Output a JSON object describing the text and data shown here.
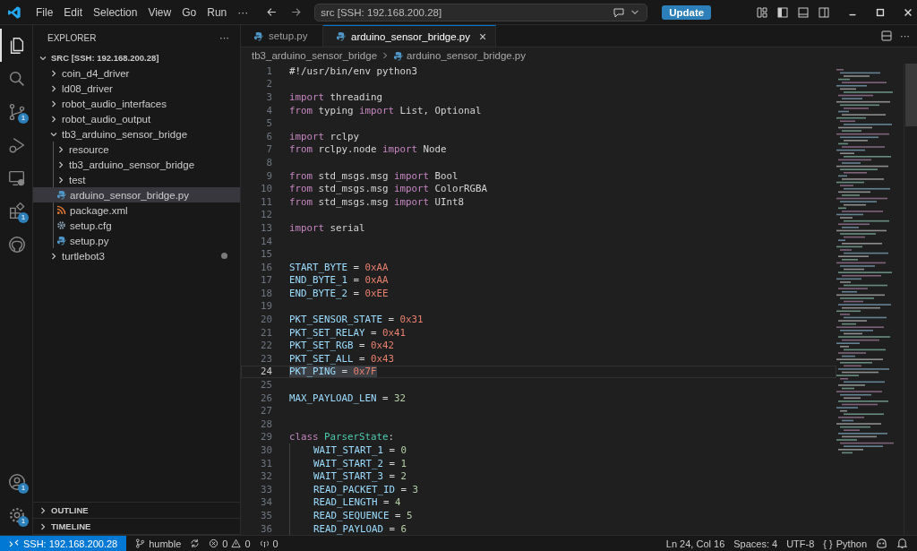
{
  "title_bar": {
    "menu": [
      "File",
      "Edit",
      "Selection",
      "View",
      "Go",
      "Run",
      "···"
    ],
    "command_center": "src [SSH: 192.168.200.28]",
    "update_button": "Update"
  },
  "activity_bar": [
    {
      "kind": "explorer",
      "selected": true
    },
    {
      "kind": "search",
      "selected": false
    },
    {
      "kind": "source-control",
      "selected": false,
      "badge": "1"
    },
    {
      "kind": "run-debug",
      "selected": false
    },
    {
      "kind": "remote",
      "selected": false
    },
    {
      "kind": "extensions",
      "selected": false,
      "badge": "1"
    },
    {
      "kind": "github",
      "selected": false
    }
  ],
  "activity_bar_bottom": [
    {
      "kind": "account",
      "badge": "1"
    },
    {
      "kind": "settings",
      "badge": "1"
    }
  ],
  "explorer": {
    "title": "EXPLORER",
    "more": "···",
    "root": {
      "label": "SRC [SSH: 192.168.200.28]",
      "expanded": true,
      "children": [
        {
          "label": "coin_d4_driver",
          "kind": "folder",
          "expanded": false,
          "selected": false,
          "modified": false
        },
        {
          "label": "ld08_driver",
          "kind": "folder",
          "expanded": false,
          "selected": false,
          "modified": false
        },
        {
          "label": "robot_audio_interfaces",
          "kind": "folder",
          "expanded": false,
          "selected": false,
          "modified": false
        },
        {
          "label": "robot_audio_output",
          "kind": "folder",
          "expanded": false,
          "selected": false,
          "modified": false
        },
        {
          "label": "tb3_arduino_sensor_bridge",
          "kind": "folder",
          "expanded": true,
          "selected": false,
          "modified": false,
          "children": [
            {
              "label": "resource",
              "kind": "folder",
              "expanded": false,
              "selected": false,
              "modified": false
            },
            {
              "label": "tb3_arduino_sensor_bridge",
              "kind": "folder",
              "expanded": false,
              "selected": false,
              "modified": false
            },
            {
              "label": "test",
              "kind": "folder",
              "expanded": false,
              "selected": false,
              "modified": false
            },
            {
              "label": "arduino_sensor_bridge.py",
              "kind": "python",
              "selected": true,
              "modified": false
            },
            {
              "label": "package.xml",
              "kind": "xml",
              "selected": false,
              "modified": false
            },
            {
              "label": "setup.cfg",
              "kind": "config",
              "selected": false,
              "modified": false
            },
            {
              "label": "setup.py",
              "kind": "python",
              "selected": false,
              "modified": false
            }
          ]
        },
        {
          "label": "turtlebot3",
          "kind": "folder",
          "expanded": false,
          "selected": false,
          "modified": true
        }
      ]
    }
  },
  "panels": [
    {
      "label": "OUTLINE",
      "expanded": false
    },
    {
      "label": "TIMELINE",
      "expanded": false
    }
  ],
  "tabs": [
    {
      "label": "setup.py",
      "selected": false
    },
    {
      "label": "arduino_sensor_bridge.py",
      "selected": true,
      "close": "×"
    }
  ],
  "breadcrumbs": [
    "tb3_arduino_sensor_bridge",
    "arduino_sensor_bridge.py"
  ],
  "code": [
    {
      "number": "1",
      "current": false,
      "tokens": [
        {
          "kind": "text",
          "text": "#!/usr/bin/env python3"
        }
      ]
    },
    {
      "number": "2",
      "current": false
    },
    {
      "number": "3",
      "current": false,
      "tokens": [
        {
          "kind": "kw",
          "text": "import"
        },
        {
          "kind": "text",
          "text": " threading"
        }
      ]
    },
    {
      "number": "4",
      "current": false,
      "tokens": [
        {
          "kind": "kw",
          "text": "from"
        },
        {
          "kind": "text",
          "text": " typing "
        },
        {
          "kind": "kw",
          "text": "import"
        },
        {
          "kind": "text",
          "text": " List, Optional"
        }
      ]
    },
    {
      "number": "5",
      "current": false
    },
    {
      "number": "6",
      "current": false,
      "tokens": [
        {
          "kind": "kw",
          "text": "import"
        },
        {
          "kind": "text",
          "text": " rclpy"
        }
      ]
    },
    {
      "number": "7",
      "current": false,
      "tokens": [
        {
          "kind": "kw",
          "text": "from"
        },
        {
          "kind": "text",
          "text": " rclpy.node "
        },
        {
          "kind": "kw",
          "text": "import"
        },
        {
          "kind": "text",
          "text": " Node"
        }
      ]
    },
    {
      "number": "8",
      "current": false
    },
    {
      "number": "9",
      "current": false,
      "tokens": [
        {
          "kind": "kw",
          "text": "from"
        },
        {
          "kind": "text",
          "text": " std_msgs.msg "
        },
        {
          "kind": "kw",
          "text": "import"
        },
        {
          "kind": "text",
          "text": " Bool"
        }
      ]
    },
    {
      "number": "10",
      "current": false,
      "tokens": [
        {
          "kind": "kw",
          "text": "from"
        },
        {
          "kind": "text",
          "text": " std_msgs.msg "
        },
        {
          "kind": "kw",
          "text": "import"
        },
        {
          "kind": "text",
          "text": " ColorRGBA"
        }
      ]
    },
    {
      "number": "11",
      "current": false,
      "tokens": [
        {
          "kind": "kw",
          "text": "from"
        },
        {
          "kind": "text",
          "text": " std_msgs.msg "
        },
        {
          "kind": "kw",
          "text": "import"
        },
        {
          "kind": "text",
          "text": " UInt8"
        }
      ]
    },
    {
      "number": "12",
      "current": false
    },
    {
      "number": "13",
      "current": false,
      "tokens": [
        {
          "kind": "kw",
          "text": "import"
        },
        {
          "kind": "text",
          "text": " serial"
        }
      ]
    },
    {
      "number": "14",
      "current": false
    },
    {
      "number": "15",
      "current": false
    },
    {
      "number": "16",
      "current": false,
      "tokens": [
        {
          "kind": "var",
          "text": "START_BYTE"
        },
        {
          "kind": "text",
          "text": " = "
        },
        {
          "kind": "hex",
          "text": "0xAA"
        }
      ]
    },
    {
      "number": "17",
      "current": false,
      "tokens": [
        {
          "kind": "var",
          "text": "END_BYTE_1"
        },
        {
          "kind": "text",
          "text": " = "
        },
        {
          "kind": "hex",
          "text": "0xAA"
        }
      ]
    },
    {
      "number": "18",
      "current": false,
      "tokens": [
        {
          "kind": "var",
          "text": "END_BYTE_2"
        },
        {
          "kind": "text",
          "text": " = "
        },
        {
          "kind": "hex",
          "text": "0xEE"
        }
      ]
    },
    {
      "number": "19",
      "current": false
    },
    {
      "number": "20",
      "current": false,
      "tokens": [
        {
          "kind": "var",
          "text": "PKT_SENSOR_STATE"
        },
        {
          "kind": "text",
          "text": " = "
        },
        {
          "kind": "hex",
          "text": "0x31"
        }
      ]
    },
    {
      "number": "21",
      "current": false,
      "tokens": [
        {
          "kind": "var",
          "text": "PKT_SET_RELAY"
        },
        {
          "kind": "text",
          "text": " = "
        },
        {
          "kind": "hex",
          "text": "0x41"
        }
      ]
    },
    {
      "number": "22",
      "current": false,
      "tokens": [
        {
          "kind": "var",
          "text": "PKT_SET_RGB"
        },
        {
          "kind": "text",
          "text": " = "
        },
        {
          "kind": "hex",
          "text": "0x42"
        }
      ]
    },
    {
      "number": "23",
      "current": false,
      "tokens": [
        {
          "kind": "var",
          "text": "PKT_SET_ALL"
        },
        {
          "kind": "text",
          "text": " = "
        },
        {
          "kind": "hex",
          "text": "0x43"
        }
      ]
    },
    {
      "number": "24",
      "current": true,
      "tokens": [
        {
          "kind": "var",
          "text": "PKT_PING"
        },
        {
          "kind": "text",
          "text": " = "
        },
        {
          "kind": "hex",
          "text": "0x7F"
        }
      ]
    },
    {
      "number": "25",
      "current": false
    },
    {
      "number": "26",
      "current": false,
      "tokens": [
        {
          "kind": "var",
          "text": "MAX_PAYLOAD_LEN"
        },
        {
          "kind": "text",
          "text": " = "
        },
        {
          "kind": "num",
          "text": "32"
        }
      ]
    },
    {
      "number": "27",
      "current": false
    },
    {
      "number": "28",
      "current": false
    },
    {
      "number": "29",
      "current": false,
      "tokens": [
        {
          "kind": "kw",
          "text": "class "
        },
        {
          "kind": "cls",
          "text": "ParserState"
        },
        {
          "kind": "text",
          "text": ":"
        }
      ]
    },
    {
      "number": "30",
      "current": false,
      "indented": true,
      "tokens": [
        {
          "kind": "var",
          "text": "WAIT_START_1"
        },
        {
          "kind": "text",
          "text": " = "
        },
        {
          "kind": "num",
          "text": "0"
        }
      ]
    },
    {
      "number": "31",
      "current": false,
      "indented": true,
      "tokens": [
        {
          "kind": "var",
          "text": "WAIT_START_2"
        },
        {
          "kind": "text",
          "text": " = "
        },
        {
          "kind": "num",
          "text": "1"
        }
      ]
    },
    {
      "number": "32",
      "current": false,
      "indented": true,
      "tokens": [
        {
          "kind": "var",
          "text": "WAIT_START_3"
        },
        {
          "kind": "text",
          "text": " = "
        },
        {
          "kind": "num",
          "text": "2"
        }
      ]
    },
    {
      "number": "33",
      "current": false,
      "indented": true,
      "tokens": [
        {
          "kind": "var",
          "text": "READ_PACKET_ID"
        },
        {
          "kind": "text",
          "text": " = "
        },
        {
          "kind": "num",
          "text": "3"
        }
      ]
    },
    {
      "number": "34",
      "current": false,
      "indented": true,
      "tokens": [
        {
          "kind": "var",
          "text": "READ_LENGTH"
        },
        {
          "kind": "text",
          "text": " = "
        },
        {
          "kind": "num",
          "text": "4"
        }
      ]
    },
    {
      "number": "35",
      "current": false,
      "indented": true,
      "tokens": [
        {
          "kind": "var",
          "text": "READ_SEQUENCE"
        },
        {
          "kind": "text",
          "text": " = "
        },
        {
          "kind": "num",
          "text": "5"
        }
      ]
    },
    {
      "number": "36",
      "current": false,
      "indented": true,
      "tokens": [
        {
          "kind": "var",
          "text": "READ_PAYLOAD"
        },
        {
          "kind": "text",
          "text": " = "
        },
        {
          "kind": "num",
          "text": "6"
        }
      ]
    }
  ],
  "status_bar": {
    "remote": "SSH: 192.168.200.28",
    "branch": "humble",
    "errors": "0",
    "warnings": "0",
    "ports": "0",
    "position": "Ln 24, Col 16",
    "indentation": "Spaces: 4",
    "encoding": "UTF-8",
    "language_icon": "{ }",
    "language": "Python"
  }
}
